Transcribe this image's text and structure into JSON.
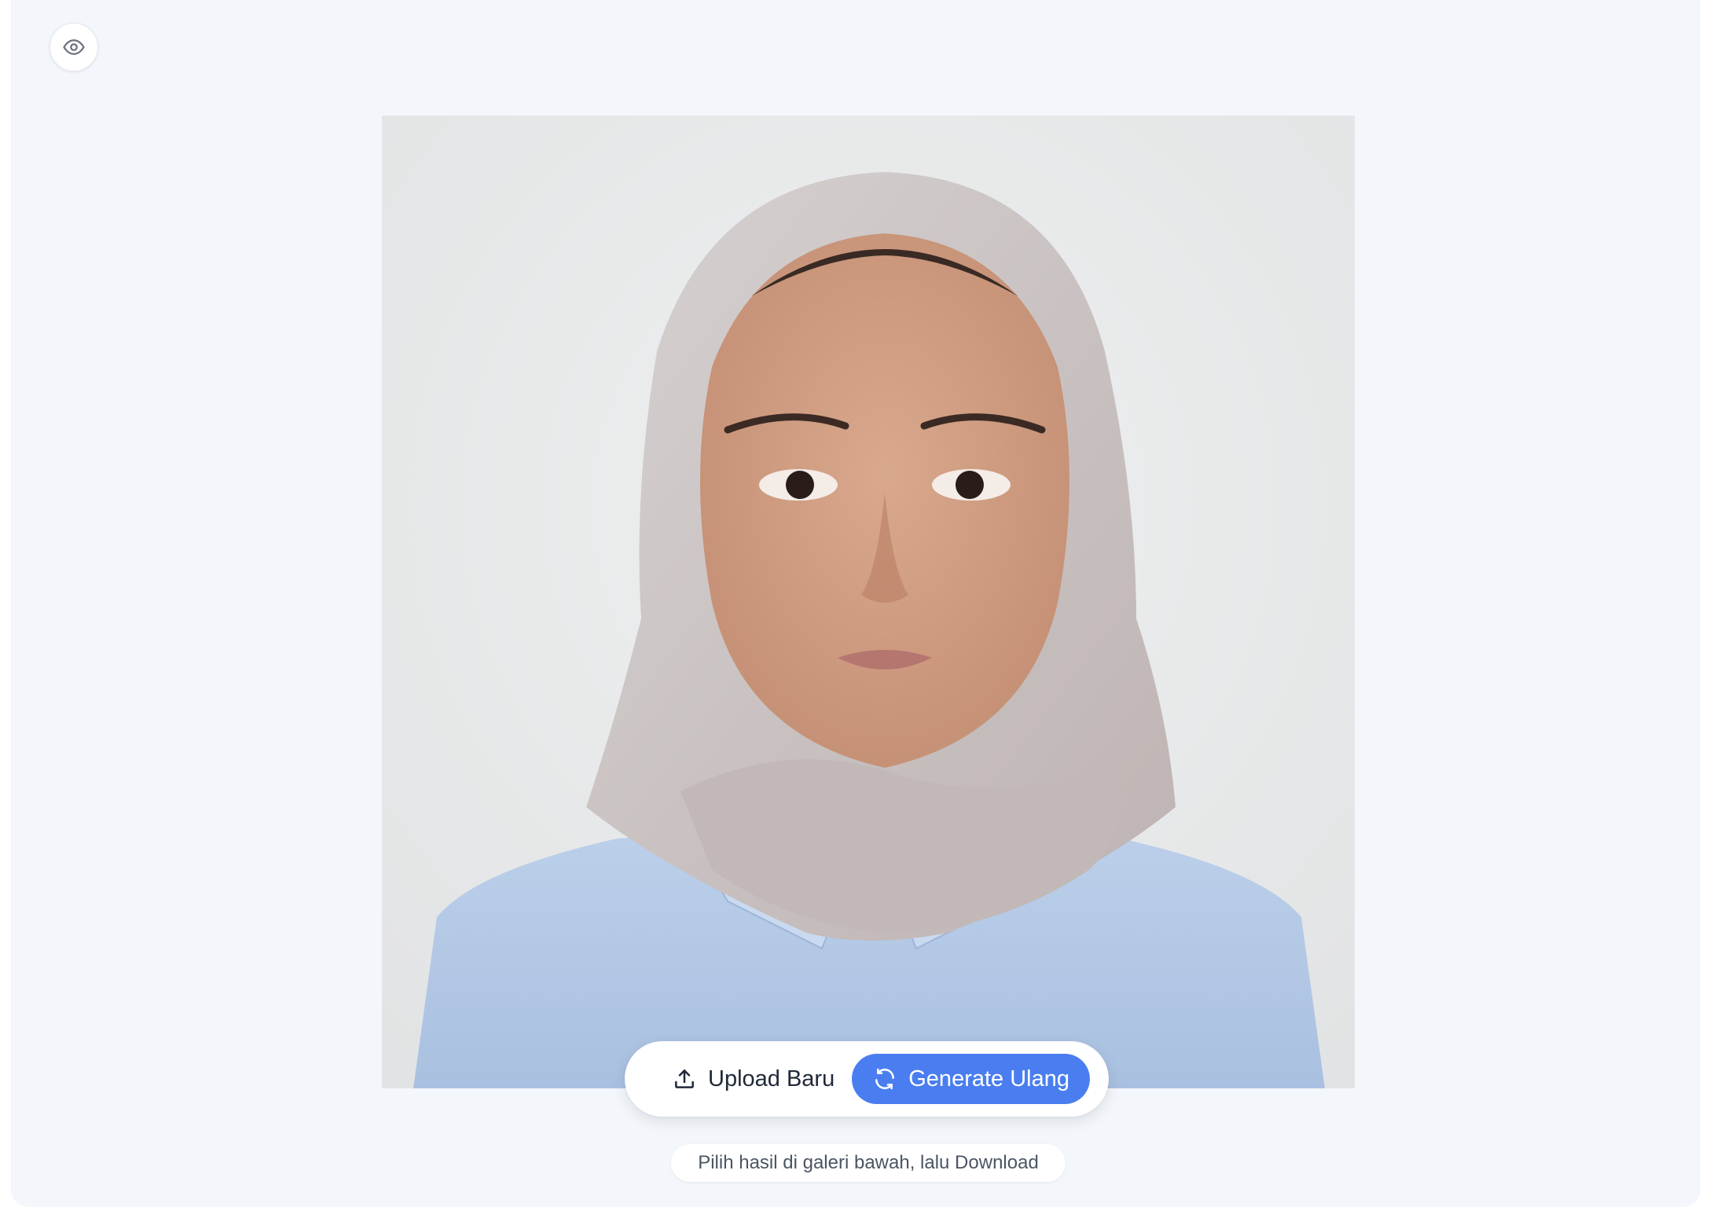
{
  "toolbar": {
    "preview_icon": "eye-icon"
  },
  "photo": {
    "background_color": "#e8e9ea"
  },
  "actions": {
    "upload_label": "Upload Baru",
    "upload_icon": "upload-icon",
    "generate_label": "Generate Ulang",
    "generate_icon": "refresh-icon",
    "accent_color": "#4a7ef0"
  },
  "hint": {
    "text": "Pilih hasil di galeri bawah, lalu Download"
  }
}
